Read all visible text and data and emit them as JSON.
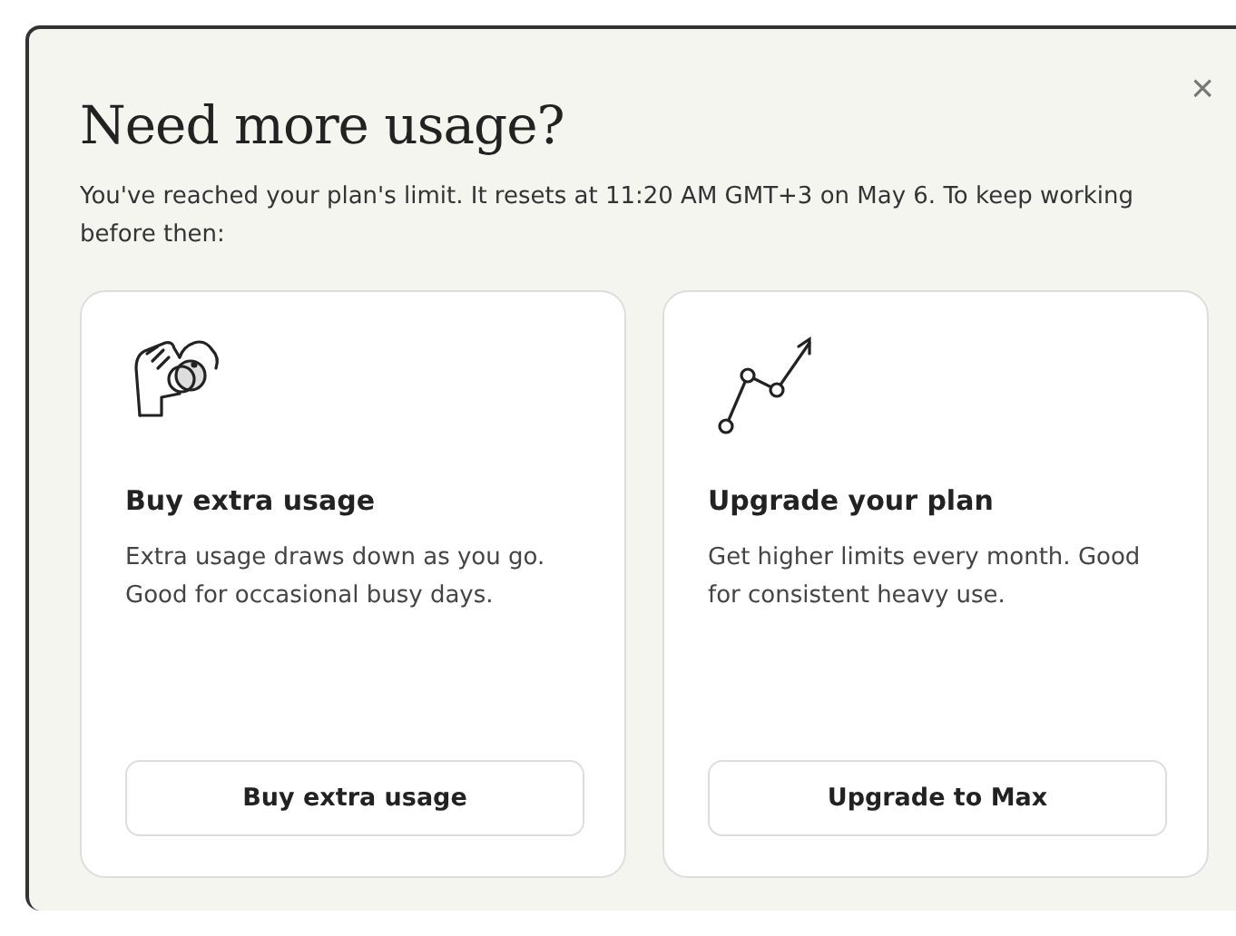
{
  "dialog": {
    "title": "Need more usage?",
    "close": "×",
    "message": "You've reached your plan's limit. It resets at 11:20 AM GMT+3 on May 6. To keep working before then:"
  },
  "options": [
    {
      "kind": "hand",
      "title": "Buy extra usage",
      "description": "Extra usage draws down as you go. Good for occasional busy days.",
      "button": "Buy extra usage"
    },
    {
      "kind": "chart",
      "title": "Upgrade your plan",
      "description": "Get higher limits every month. Good for consistent heavy use.",
      "button": "Upgrade to Max"
    }
  ]
}
